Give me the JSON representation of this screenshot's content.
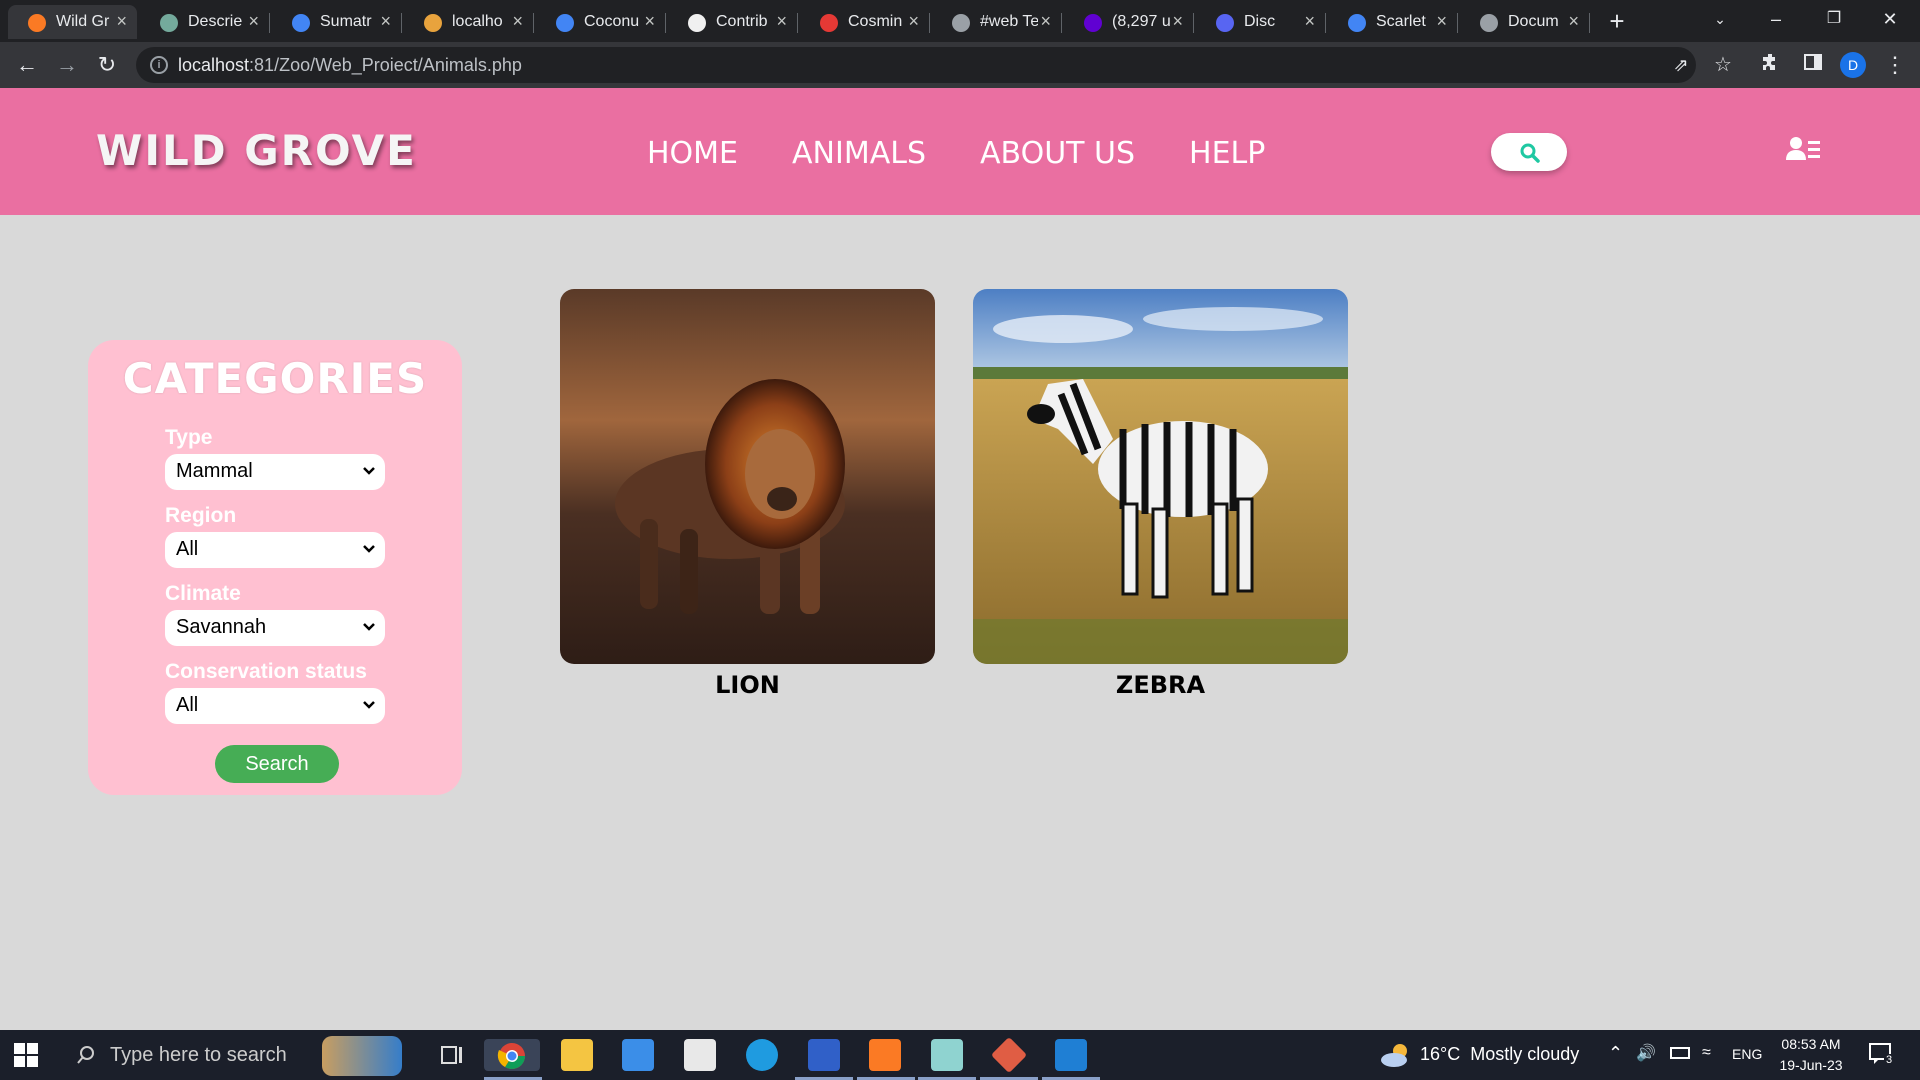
{
  "browser": {
    "tabs": [
      {
        "title": "Wild Gr",
        "icon": "xampp-icon",
        "color": "#fb7a24",
        "active": true
      },
      {
        "title": "Descrie",
        "icon": "chatgpt-icon",
        "color": "#74aa9c"
      },
      {
        "title": "Sumatr",
        "icon": "google-icon",
        "color": "#4285f4"
      },
      {
        "title": "localho",
        "icon": "localhost-icon",
        "color": "#e8a33d"
      },
      {
        "title": "Coconu",
        "icon": "google-icon",
        "color": "#4285f4"
      },
      {
        "title": "Contrib",
        "icon": "github-icon",
        "color": "#f0f0f0"
      },
      {
        "title": "Cosmin",
        "icon": "cv-icon",
        "color": "#e53935"
      },
      {
        "title": "#web Te",
        "icon": "globe-icon",
        "color": "#9aa0a6"
      },
      {
        "title": "(8,297 u",
        "icon": "mail-icon",
        "color": "#6001d2"
      },
      {
        "title": "Disc",
        "icon": "discord-icon",
        "color": "#5865f2"
      },
      {
        "title": "Scarlet",
        "icon": "google-icon",
        "color": "#4285f4"
      },
      {
        "title": "Docum",
        "icon": "globe-icon",
        "color": "#9aa0a6"
      }
    ],
    "url_host": "localhost",
    "url_rest": ":81/Zoo/Web_Proiect/Animals.php",
    "profile_initial": "D"
  },
  "site": {
    "logo": "WILD GROVE",
    "nav": [
      "HOME",
      "ANIMALS",
      "ABOUT US",
      "HELP"
    ]
  },
  "filters": {
    "title": "CATEGORIES",
    "fields": [
      {
        "label": "Type",
        "value": "Mammal"
      },
      {
        "label": "Region",
        "value": "All"
      },
      {
        "label": "Climate",
        "value": "Savannah"
      },
      {
        "label": "Conservation status",
        "value": "All"
      }
    ],
    "search_label": "Search"
  },
  "animals": [
    {
      "name": "LION"
    },
    {
      "name": "ZEBRA"
    }
  ],
  "taskbar": {
    "search_placeholder": "Type here to search",
    "weather": "16°C  Mostly cloudy",
    "lang": "ENG",
    "time": "08:53 AM",
    "date": "19-Jun-23",
    "notif_count": "3"
  },
  "colors": {
    "header": "#ea6fa1",
    "panel": "#ffc0d1",
    "search_button": "#46ad55",
    "page_bg": "#d9d9d9"
  }
}
